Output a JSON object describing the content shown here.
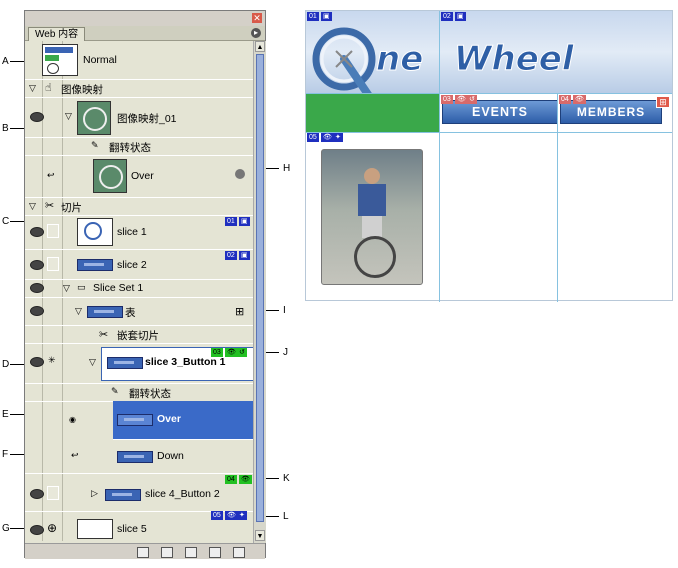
{
  "panel": {
    "tab_label": "Web 内容",
    "rows": {
      "normal": "Normal",
      "imagemap": "图像映射",
      "imagemap_01": "图像映射_01",
      "rollover_state_1": "翻转状态",
      "over_1": "Over",
      "slices": "切片",
      "slice1": "slice 1",
      "slice1_badge": "01",
      "slice2": "slice 2",
      "slice2_badge": "02",
      "sliceset": "Slice Set 1",
      "table": "表",
      "nested": "嵌套切片",
      "slice3": "slice 3_Button 1",
      "slice3_badge": "03",
      "rollover_state_2": "翻转状态",
      "over_2": "Over",
      "down": "Down",
      "slice4_badge": "04",
      "slice4": "slice 4_Button 2",
      "slice5_badge": "05",
      "slice5": "slice 5"
    }
  },
  "callouts": [
    "A",
    "B",
    "C",
    "D",
    "E",
    "F",
    "G",
    "H",
    "I",
    "J",
    "K",
    "L"
  ],
  "mockup": {
    "logo_text_one": "ne",
    "logo_text_wheel": "Wheel",
    "slice_badges": [
      "01",
      "02",
      "03",
      "04",
      "05"
    ],
    "events_label": "EVENTS",
    "members_label": "MEMBERS"
  },
  "colors": {
    "panel_bg": "#e4e4d4",
    "selected_row": "#3a6ac8",
    "slice_badge_blue": "#1f2fbf",
    "slice_badge_green": "#22c022",
    "nav_button": "#3d6db8",
    "green_cell": "#3aa84a"
  }
}
